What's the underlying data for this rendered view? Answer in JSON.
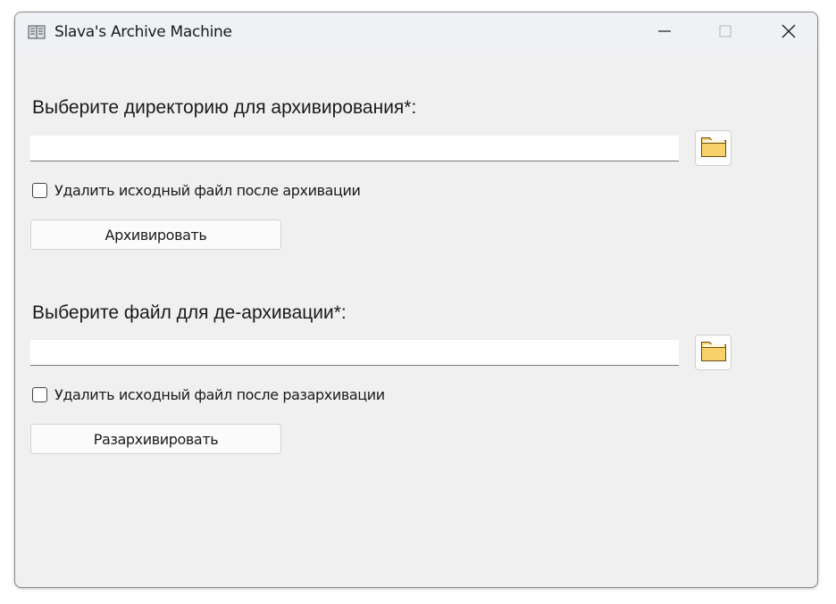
{
  "window": {
    "title": "Slava's Archive Machine",
    "icon": "archive-app-icon",
    "controls": {
      "minimize": "minimize-icon",
      "maximize": "maximize-icon",
      "close": "close-icon"
    }
  },
  "archive": {
    "label": "Выберите директорию для архивирования*:",
    "path_value": "",
    "browse_icon": "folder-icon",
    "delete_checkbox_label": "Удалить исходный файл после архивации",
    "delete_checked": false,
    "button_label": "Архивировать"
  },
  "unarchive": {
    "label": "Выберите файл для де-архивации*:",
    "path_value": "",
    "browse_icon": "folder-icon",
    "delete_checkbox_label": "Удалить исходный файл после разархивации",
    "delete_checked": false,
    "button_label": "Разархивировать"
  },
  "colors": {
    "window_bg": "#f0f0f0",
    "titlebar_bg": "#eff1f4",
    "folder_fill": "#f7d26b",
    "folder_stroke": "#6b4e12"
  }
}
